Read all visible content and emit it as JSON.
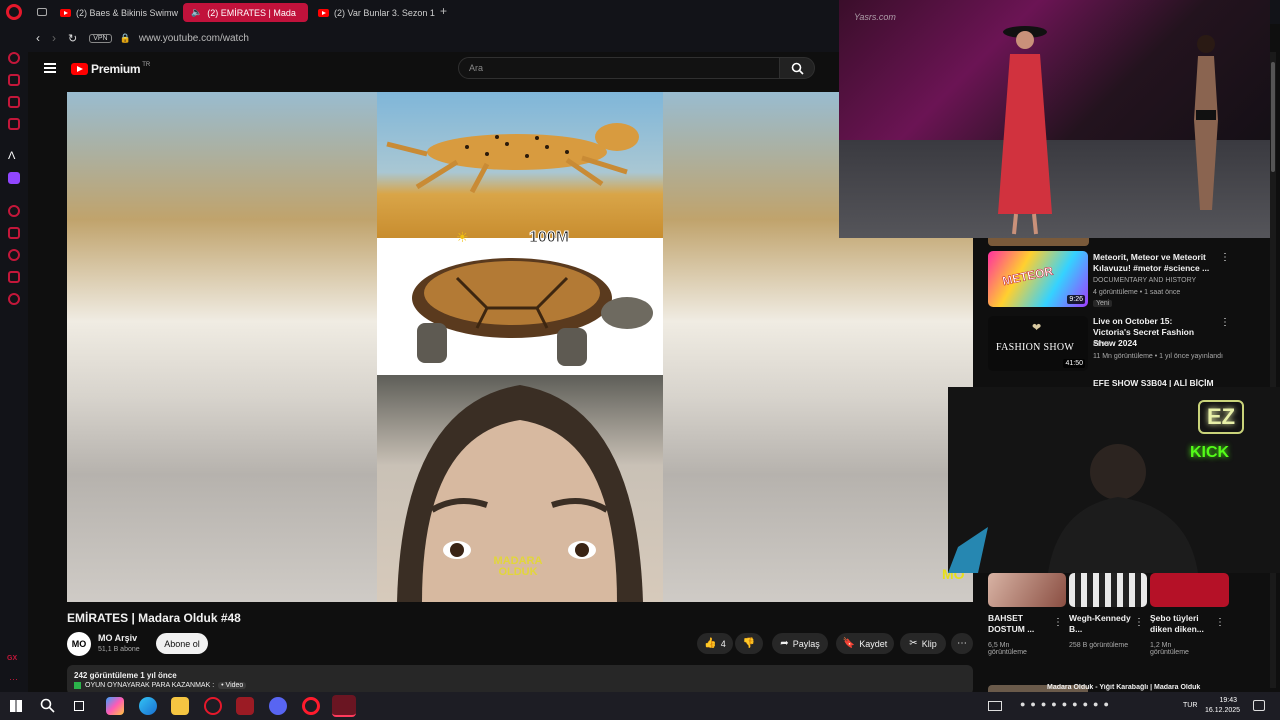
{
  "browser": {
    "tabs": [
      {
        "label": "(2) Baes & Bikinis Swimw"
      },
      {
        "label": "(2) EMİRATES | Mada"
      },
      {
        "label": "(2) Var Bunlar 3. Sezon 1."
      }
    ],
    "url": "www.youtube.com/watch",
    "vpn_label": "VPN",
    "sidebar_bottom_label": "GX"
  },
  "youtube": {
    "brand": "Premium",
    "brand_suffix": "TR",
    "search_placeholder": "Ara",
    "video": {
      "overlay_text": "100M",
      "watermark": "MADARA OLDUK",
      "corner_logo": "MO"
    },
    "title": "EMİRATES | Madara Olduk #48",
    "channel": {
      "avatar_text": "MO",
      "name": "MO Arşiv",
      "subscribers": "51,1 B abone",
      "subscribe_label": "Abone ol"
    },
    "actions": {
      "like_count": "4",
      "share_label": "Paylaş",
      "save_label": "Kaydet",
      "clip_label": "Klip"
    },
    "description": {
      "stats": "242 görüntüleme  1 yıl önce",
      "line": "OYUN OYNAYARAK PARA KAZANMAK :",
      "tag": "• Video"
    },
    "recommendations": [
      {
        "title": "Meteorit, Meteor ve Meteorit Kılavuzu! #metor #science ...",
        "channel": "DOCUMENTARY AND HISTORY",
        "meta": "4 görüntüleme • 1 saat önce",
        "badge": "Yeni",
        "duration": "9:26",
        "thumb_text": "METEOR"
      },
      {
        "title": "Live on October 15: Victoria's Secret Fashion Show 2024",
        "channel": "PINK",
        "meta": "11 Mn görüntüleme • 1 yıl önce yayınlandı",
        "duration": "41:50",
        "thumb_text": "FASHION SHOW"
      },
      {
        "title": "EFE SHOW S3B04 | ALİ BİÇİM"
      }
    ],
    "shorts": [
      {
        "title": "BAHSET DOSTUM ...",
        "views": "6,5 Mn görüntüleme"
      },
      {
        "title": "Wegh-Kennedy B...",
        "views": "258 B görüntüleme"
      },
      {
        "title": "Şebo tüyleri diken diken...",
        "views": "1,2 Mn görüntüleme"
      }
    ],
    "bottom_rec_title": "Madara Olduk - Yiğit Karabağlı | Madara Olduk"
  },
  "overlays": {
    "stream_watermark": "Yasrs.com",
    "kick_badge_top": "EZ",
    "kick_badge_bottom": "KICK"
  },
  "taskbar": {
    "lang": "TUR",
    "time": "19:43",
    "date": "16.12.2025"
  },
  "colors": {
    "accent": "#c1123b",
    "yt_red": "#ff0000",
    "kick_green": "#53fc18"
  }
}
